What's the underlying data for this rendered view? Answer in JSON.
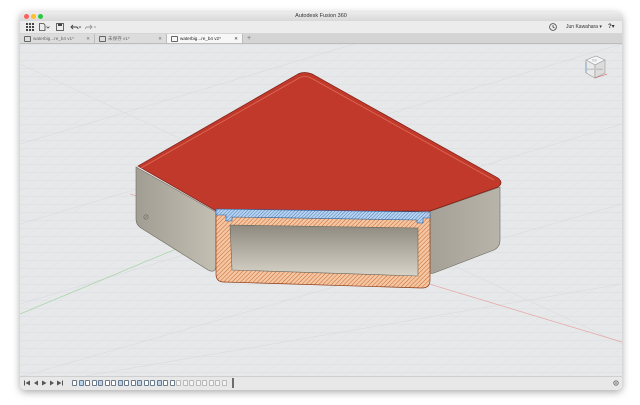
{
  "app": {
    "title": "Autodesk Fusion 360"
  },
  "toolbar": {
    "user_name": "Jun Kawahara ▾",
    "help_label": "?▾"
  },
  "tabs": [
    {
      "label": "waterbig...re_b4 v1*",
      "active": false
    },
    {
      "label": "未保存 v1*",
      "active": false
    },
    {
      "label": "waterbig...re_b4 v2*",
      "active": true
    }
  ],
  "new_tab_label": "+",
  "viewcube": {
    "top": "TOP",
    "front": "FRONT",
    "right": "RIGHT"
  },
  "model": {
    "top_face_color": "#c0392b",
    "side_face_color": "#b3ae9f",
    "section_wall_color": "#f2c29b",
    "section_hatch_color": "#c9662d",
    "section_lid_color": "#a9c8ea",
    "section_lid_hatch": "#3b6fb0"
  },
  "timeline": {
    "controls": [
      "skip-back-icon",
      "step-back-icon",
      "play-icon",
      "step-forward-icon",
      "skip-forward-icon"
    ],
    "features": [
      "sketch",
      "extrude",
      "sketch",
      "extrude",
      "fillet",
      "sketch",
      "extrude",
      "shell",
      "sketch",
      "extrude",
      "chamfer",
      "sketch",
      "sketch",
      "sketch",
      "extrude",
      "section",
      "plane",
      "plane",
      "plane",
      "plane",
      "plane",
      "plane",
      "plane",
      "plane"
    ]
  }
}
